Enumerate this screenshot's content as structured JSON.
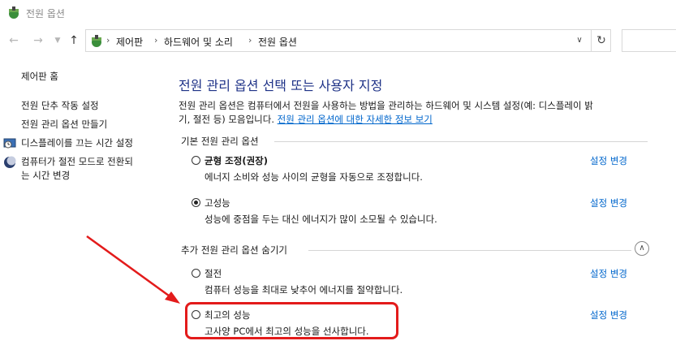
{
  "window": {
    "title": "전원 옵션"
  },
  "address_bar": {
    "crumbs": [
      "제어판",
      "하드웨어 및 소리",
      "전원 옵션"
    ]
  },
  "sidebar": {
    "items": [
      {
        "label": "제어판 홈",
        "icon": null
      },
      {
        "label": "전원 단추 작동 설정",
        "icon": null
      },
      {
        "label": "전원 관리 옵션 만들기",
        "icon": null
      },
      {
        "label": "디스플레이를 끄는 시간 설정",
        "icon": "clock-monitor-icon"
      },
      {
        "label_line1": "컴퓨터가 절전 모드로 전환되",
        "label_line2": "는 시간 변경",
        "icon": "moon-icon"
      }
    ]
  },
  "main": {
    "heading": "전원 관리 옵션 선택 또는 사용자 지정",
    "description_line1": "전원 관리 옵션은 컴퓨터에서 전원을 사용하는 방법을 관리하는 하드웨어 및 시스템 설정(예: 디스플레이 밝",
    "description_line2": "기, 절전 등) 모음입니다. ",
    "description_link": "전원 관리 옵션에 대한 자세한 정보 보기",
    "basic_group_label": "기본 전원 관리 옵션",
    "additional_group_label": "추가 전원 관리 옵션 숨기기",
    "change_label": "설정 변경",
    "plans": [
      {
        "name": "균형 조정(권장)",
        "description": "에너지 소비와 성능 사이의 균형을 자동으로 조정합니다.",
        "selected": false,
        "bold": true
      },
      {
        "name": "고성능",
        "description": "성능에 중점을 두는 대신 에너지가 많이 소모될 수 있습니다.",
        "selected": true,
        "bold": false
      },
      {
        "name": "절전",
        "description": "컴퓨터 성능을 최대로 낮추어 에너지를 절약합니다.",
        "selected": false,
        "bold": false
      },
      {
        "name": "최고의 성능",
        "description": "고사양 PC에서 최고의 성능을 선사합니다.",
        "selected": false,
        "bold": false
      }
    ]
  },
  "colors": {
    "heading": "#1e3287",
    "link": "#0066cc",
    "highlight": "#e31b1b"
  }
}
